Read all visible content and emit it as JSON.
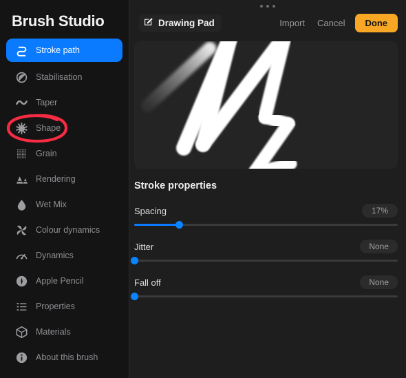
{
  "sidebar": {
    "title": "Brush Studio",
    "items": [
      {
        "label": "Stroke path",
        "icon": "stroke-path-icon",
        "active": true
      },
      {
        "label": "Stabilisation",
        "icon": "stabilisation-icon",
        "active": false
      },
      {
        "label": "Taper",
        "icon": "taper-icon",
        "active": false
      },
      {
        "label": "Shape",
        "icon": "shape-icon",
        "active": false
      },
      {
        "label": "Grain",
        "icon": "grain-icon",
        "active": false
      },
      {
        "label": "Rendering",
        "icon": "rendering-icon",
        "active": false
      },
      {
        "label": "Wet Mix",
        "icon": "wet-mix-icon",
        "active": false
      },
      {
        "label": "Colour dynamics",
        "icon": "colour-dynamics-icon",
        "active": false
      },
      {
        "label": "Dynamics",
        "icon": "dynamics-icon",
        "active": false
      },
      {
        "label": "Apple Pencil",
        "icon": "apple-pencil-icon",
        "active": false
      },
      {
        "label": "Properties",
        "icon": "properties-icon",
        "active": false
      },
      {
        "label": "Materials",
        "icon": "materials-icon",
        "active": false
      },
      {
        "label": "About this brush",
        "icon": "about-brush-icon",
        "active": false
      }
    ]
  },
  "header": {
    "pad_label": "Drawing Pad",
    "pad_icon": "edit-square-icon",
    "import_label": "Import",
    "cancel_label": "Cancel",
    "done_label": "Done"
  },
  "preview": {
    "name": "brush-stroke-preview"
  },
  "properties": {
    "section_title": "Stroke properties",
    "rows": [
      {
        "label": "Spacing",
        "value": "17%",
        "percent": 17
      },
      {
        "label": "Jitter",
        "value": "None",
        "percent": 0
      },
      {
        "label": "Fall off",
        "value": "None",
        "percent": 0
      }
    ]
  },
  "annotation": {
    "name": "red-circle-annotation",
    "target": "Shape",
    "color": "#f52c43"
  },
  "colors": {
    "accent_blue": "#0a7aff",
    "done_orange": "#f7a723",
    "sidebar_bg": "#141414",
    "main_bg": "#1e1e1e",
    "annotation_red": "#f52c43"
  }
}
